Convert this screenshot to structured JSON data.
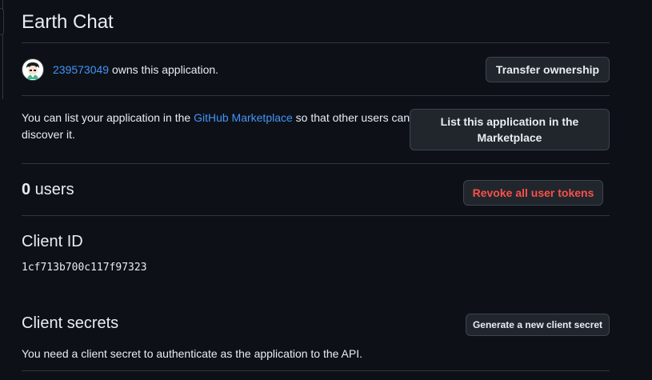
{
  "app": {
    "title": "Earth Chat"
  },
  "owner": {
    "username": "239573049",
    "suffix": " owns this application.",
    "transfer_label": "Transfer ownership"
  },
  "marketplace": {
    "text_prefix": "You can list your application in the ",
    "link_label": "GitHub Marketplace",
    "text_suffix": " so that other users can discover it.",
    "button_label": "List this application in the Marketplace"
  },
  "users": {
    "count": "0",
    "label": " users",
    "revoke_label": "Revoke all user tokens"
  },
  "client_id": {
    "heading": "Client ID",
    "value": "1cf713b700c117f97323"
  },
  "client_secrets": {
    "heading": "Client secrets",
    "generate_label": "Generate a new client secret",
    "description": "You need a client secret to authenticate as the application to the API."
  },
  "colors": {
    "background": "#0d1117",
    "text": "#e6edf3",
    "link": "#4493f8",
    "danger": "#f85149",
    "border": "#30363d",
    "button_bg": "#21262d"
  },
  "icons": {
    "avatar": "identicon-avatar"
  }
}
